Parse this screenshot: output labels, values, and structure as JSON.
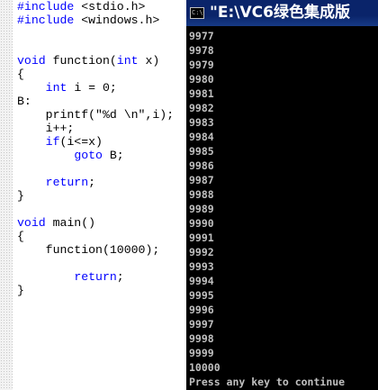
{
  "editor": {
    "lines": [
      [
        {
          "t": "#include",
          "c": "kw"
        },
        {
          "t": " <stdio.h>",
          "c": ""
        }
      ],
      [
        {
          "t": "#include",
          "c": "kw"
        },
        {
          "t": " <windows.h>",
          "c": ""
        }
      ],
      [],
      [],
      [
        {
          "t": "void",
          "c": "kw"
        },
        {
          "t": " function(",
          "c": ""
        },
        {
          "t": "int",
          "c": "kw"
        },
        {
          "t": " x)",
          "c": ""
        }
      ],
      [
        {
          "t": "{",
          "c": ""
        }
      ],
      [
        {
          "t": "    ",
          "c": ""
        },
        {
          "t": "int",
          "c": "kw"
        },
        {
          "t": " i = 0;",
          "c": ""
        }
      ],
      [
        {
          "t": "B:",
          "c": ""
        }
      ],
      [
        {
          "t": "    printf(\"%d \\n\",i);",
          "c": ""
        }
      ],
      [
        {
          "t": "    i++;",
          "c": ""
        }
      ],
      [
        {
          "t": "    ",
          "c": ""
        },
        {
          "t": "if",
          "c": "kw"
        },
        {
          "t": "(i<=x)",
          "c": ""
        }
      ],
      [
        {
          "t": "        ",
          "c": ""
        },
        {
          "t": "goto",
          "c": "kw"
        },
        {
          "t": " B;",
          "c": ""
        }
      ],
      [],
      [
        {
          "t": "    ",
          "c": ""
        },
        {
          "t": "return",
          "c": "kw"
        },
        {
          "t": ";",
          "c": ""
        }
      ],
      [
        {
          "t": "}",
          "c": ""
        }
      ],
      [],
      [
        {
          "t": "void",
          "c": "kw"
        },
        {
          "t": " main()",
          "c": ""
        }
      ],
      [
        {
          "t": "{",
          "c": ""
        }
      ],
      [
        {
          "t": "    function(10000);",
          "c": ""
        }
      ],
      [],
      [
        {
          "t": "        ",
          "c": ""
        },
        {
          "t": "return",
          "c": "kw"
        },
        {
          "t": ";",
          "c": ""
        }
      ],
      [
        {
          "t": "}",
          "c": ""
        }
      ]
    ]
  },
  "console": {
    "icon": "C:\\",
    "title": "\"E:\\VC6绿色集成版",
    "output_lines": [
      "9977",
      "9978",
      "9979",
      "9980",
      "9981",
      "9982",
      "9983",
      "9984",
      "9985",
      "9986",
      "9987",
      "9988",
      "9989",
      "9990",
      "9991",
      "9992",
      "9993",
      "9994",
      "9995",
      "9996",
      "9997",
      "9998",
      "9999",
      "10000",
      "Press any key to continue"
    ]
  },
  "colors": {
    "keyword": "#0000ff",
    "console_background": "#000000",
    "console_text": "#c0c0c0",
    "titlebar": "#0a246a"
  }
}
